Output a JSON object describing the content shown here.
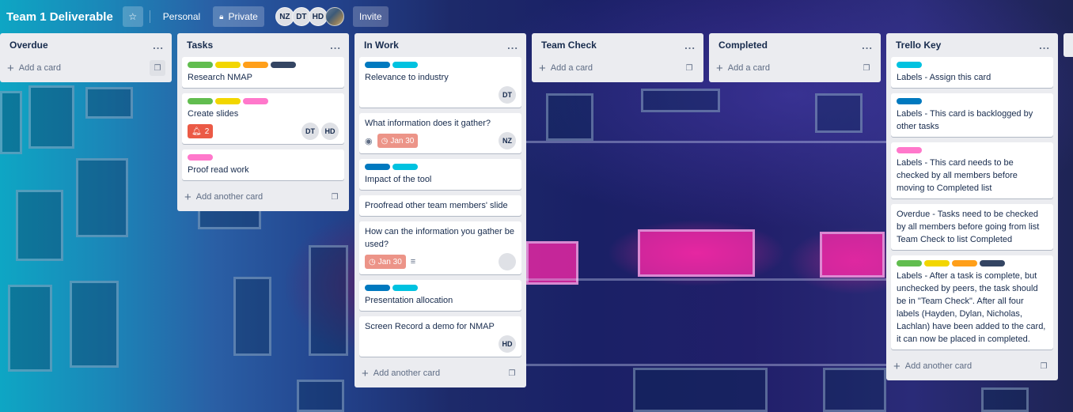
{
  "header": {
    "title": "Team 1 Deliverable",
    "star_icon": "star-icon",
    "personal": "Personal",
    "private": "Private",
    "invite": "Invite",
    "members": [
      "NZ",
      "DT",
      "HD"
    ]
  },
  "colors": {
    "green": "#61bd4f",
    "yellow": "#f2d600",
    "orange": "#ff9f1a",
    "navy": "#344563",
    "blue": "#0079bf",
    "sky": "#00c2e0",
    "pink": "#ff78cb",
    "red": "#eb5a46",
    "due": "#ec9488"
  },
  "lists": [
    {
      "name": "Overdue",
      "menu": "...",
      "add": "Add a card",
      "cards": []
    },
    {
      "name": "Tasks",
      "menu": "...",
      "add": "Add another card",
      "cards": [
        {
          "title": "Research NMAP",
          "labels": [
            "green",
            "yellow",
            "orange",
            "navy"
          ]
        },
        {
          "title": "Create slides",
          "labels": [
            "green",
            "yellow",
            "pink"
          ],
          "notification_count": "2",
          "members": [
            "DT",
            "HD"
          ]
        },
        {
          "title": "Proof read work",
          "labels": [
            "pink"
          ]
        }
      ]
    },
    {
      "name": "In Work",
      "menu": "...",
      "add": "Add another card",
      "cards": [
        {
          "title": "Relevance to industry",
          "labels": [
            "blue",
            "sky"
          ],
          "members": [
            "DT"
          ]
        },
        {
          "title": "What information does it gather?",
          "labels": [],
          "watch": true,
          "due": "Jan 30",
          "members": [
            "NZ"
          ]
        },
        {
          "title": "Impact of the tool",
          "labels": [
            "blue",
            "sky"
          ]
        },
        {
          "title": "Proofread other team members' slide",
          "labels": []
        },
        {
          "title": "How can the information you gather be used?",
          "labels": [],
          "due": "Jan 30",
          "description": true,
          "photo_member": true
        },
        {
          "title": "Presentation allocation",
          "labels": [
            "blue",
            "sky"
          ]
        },
        {
          "title": "Screen Record a demo for NMAP",
          "labels": [],
          "members": [
            "HD"
          ]
        }
      ]
    },
    {
      "name": "Team Check",
      "menu": "...",
      "add": "Add a card",
      "cards": []
    },
    {
      "name": "Completed",
      "menu": "...",
      "add": "Add a card",
      "cards": []
    },
    {
      "name": "Trello Key",
      "menu": "...",
      "add": "Add another card",
      "cards": [
        {
          "title": "Labels - Assign this card",
          "labels": [
            "sky"
          ]
        },
        {
          "title": "Labels - This card is backlogged by other tasks",
          "labels": [
            "blue"
          ]
        },
        {
          "title": "Labels - This card needs to be checked by all members before moving to Completed list",
          "labels": [
            "pink"
          ]
        },
        {
          "title": "Overdue - Tasks need to be checked by all members before going from list Team Check to list Completed",
          "labels": []
        },
        {
          "title": "Labels - After a task is complete, but unchecked by peers, the task should be in \"Team Check\". After all four labels (Hayden, Dylan, Nicholas, Lachlan) have been added to the card, it can now be placed in completed.",
          "labels": [
            "green",
            "yellow",
            "orange",
            "navy"
          ]
        }
      ]
    }
  ]
}
